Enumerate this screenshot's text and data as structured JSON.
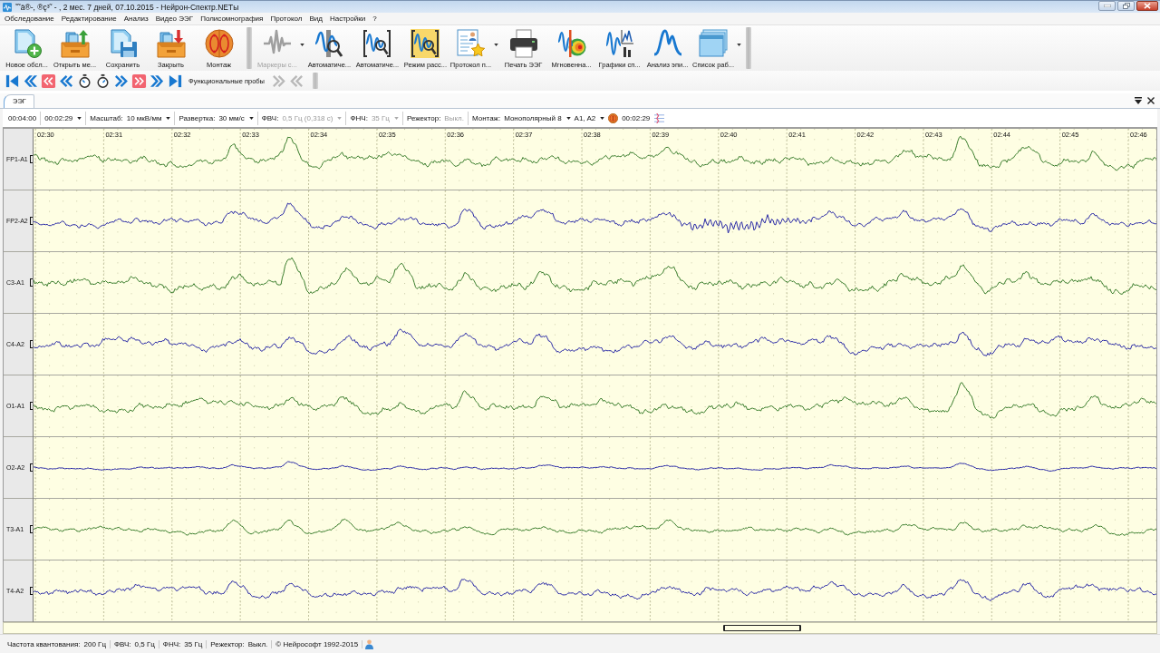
{
  "window": {
    "title": "˜˜ä®-, ®ç³˜ - , 2 мес. 7 дней, 07.10.2015 - Нейрон-Спектр.NETы"
  },
  "menu": [
    "Обследование",
    "Редактирование",
    "Анализ",
    "Видео ЭЭГ",
    "Полисомнография",
    "Протокол",
    "Вид",
    "Настройки",
    "?"
  ],
  "toolbar": {
    "groups": [
      {
        "items": [
          {
            "label": "Новое обсл...",
            "on": false,
            "disabled": false,
            "dropdown": false
          },
          {
            "label": "Открыть ме...",
            "on": false,
            "disabled": false,
            "dropdown": false
          },
          {
            "label": "Сохранить",
            "on": false,
            "disabled": false,
            "dropdown": false
          },
          {
            "label": "Закрыть",
            "on": false,
            "disabled": false,
            "dropdown": false
          },
          {
            "label": "Монтаж",
            "on": false,
            "disabled": false,
            "dropdown": false
          }
        ]
      },
      {
        "items": [
          {
            "label": "Маркеры с...",
            "on": false,
            "disabled": true,
            "dropdown": true
          },
          {
            "label": "Автоматиче...",
            "on": false,
            "disabled": false,
            "dropdown": false
          },
          {
            "label": "Автоматиче...",
            "on": false,
            "disabled": false,
            "dropdown": false
          },
          {
            "label": "Режим расс...",
            "on": true,
            "disabled": false,
            "dropdown": false
          },
          {
            "label": "Протокол п...",
            "on": false,
            "disabled": false,
            "dropdown": true
          },
          {
            "label": "Печать ЭЭГ",
            "on": false,
            "disabled": false,
            "dropdown": false
          },
          {
            "label": "Мгновенна...",
            "on": false,
            "disabled": false,
            "dropdown": false
          },
          {
            "label": "Графики сп...",
            "on": false,
            "disabled": false,
            "dropdown": false
          },
          {
            "label": "Анализ эпи...",
            "on": false,
            "disabled": false,
            "dropdown": false
          },
          {
            "label": "Список раб...",
            "on": false,
            "disabled": false,
            "dropdown": true
          }
        ]
      }
    ]
  },
  "navigation": {
    "probes_label": "Функциональные пробы",
    "probe_buttons": [
      {
        "disabled": true
      },
      {
        "disabled": true
      }
    ]
  },
  "tabs": [
    {
      "label": "ЭЭГ",
      "selected": true
    }
  ],
  "control_bar": {
    "groups": [
      {
        "items": [
          {
            "kind": "field",
            "value": "00:04:00",
            "dropdown": false,
            "disabled": false
          }
        ]
      },
      {
        "items": [
          {
            "kind": "field",
            "value": "00:02:29",
            "dropdown": true,
            "disabled": false
          }
        ]
      },
      {
        "items": [
          {
            "kind": "field",
            "label": "Масштаб:",
            "value": "10 мкВ/мм",
            "dropdown": true,
            "disabled": false
          }
        ]
      },
      {
        "items": [
          {
            "kind": "field",
            "label": "Развертка:",
            "value": "30 мм/с",
            "dropdown": true,
            "disabled": false
          }
        ]
      },
      {
        "items": [
          {
            "kind": "field",
            "label": "ФВЧ:",
            "value": "0,5 Гц (0,318 с)",
            "dropdown": true,
            "disabled": true
          }
        ]
      },
      {
        "items": [
          {
            "kind": "field",
            "label": "ФНЧ:",
            "value": "35 Гц",
            "dropdown": true,
            "disabled": true
          }
        ]
      },
      {
        "items": [
          {
            "kind": "field",
            "label": "Режектор:",
            "value": "Выкл.",
            "dropdown": false,
            "disabled": true
          }
        ]
      },
      {
        "items": [
          {
            "kind": "field",
            "label": "Монтаж:",
            "value": "Монополярный 8",
            "dropdown": true,
            "disabled": false
          },
          {
            "kind": "field",
            "value": "A1, A2",
            "dropdown": true,
            "disabled": false
          },
          {
            "kind": "clock",
            "value": "00:02:29"
          }
        ]
      }
    ]
  },
  "eeg": {
    "time_labels": [
      "02:30",
      "02:31",
      "02:32",
      "02:33",
      "02:34",
      "02:35",
      "02:36",
      "02:37",
      "02:38",
      "02:39",
      "02:40",
      "02:41",
      "02:42",
      "02:43",
      "02:44",
      "02:45",
      "02:46"
    ],
    "channels": [
      {
        "name": "FP1-A1",
        "color": "#3a7d2c"
      },
      {
        "name": "FP2-A2",
        "color": "#2a2aa6"
      },
      {
        "name": "C3-A1",
        "color": "#3a7d2c"
      },
      {
        "name": "C4-A2",
        "color": "#2a2aa6"
      },
      {
        "name": "O1-A1",
        "color": "#3a7d2c"
      },
      {
        "name": "O2-A2",
        "color": "#2a2aa6"
      },
      {
        "name": "T3-A1",
        "color": "#3a7d2c"
      },
      {
        "name": "T4-A2",
        "color": "#2a2aa6"
      }
    ]
  },
  "status_bar": [
    {
      "label": "Частота квантования:",
      "value": "200 Гц"
    },
    {
      "label": "ФВЧ:",
      "value": "0,5 Гц"
    },
    {
      "label": "ФНЧ:",
      "value": "35 Гц"
    },
    {
      "label": "Режектор:",
      "value": "Выкл."
    },
    {
      "label": "© Нейрософт 1992-2015"
    }
  ]
}
